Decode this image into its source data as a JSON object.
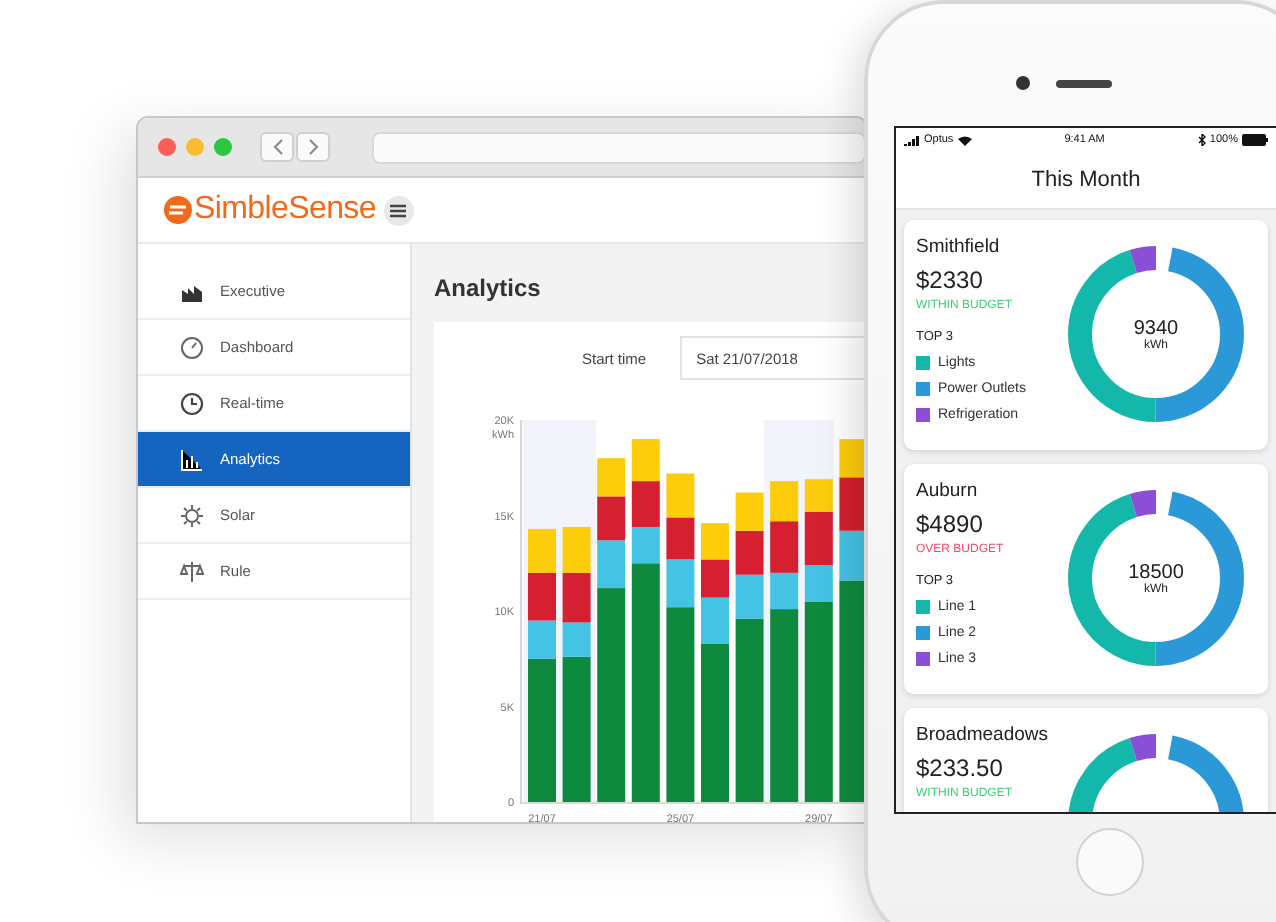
{
  "browser": {
    "logo": "SimbleSense",
    "sidebar": {
      "items": [
        {
          "label": "Executive",
          "kind": "executive",
          "selected": false
        },
        {
          "label": "Dashboard",
          "kind": "dashboard",
          "selected": false
        },
        {
          "label": "Real-time",
          "kind": "realtime",
          "selected": false
        },
        {
          "label": "Analytics",
          "kind": "analytics",
          "selected": true
        },
        {
          "label": "Solar",
          "kind": "solar",
          "selected": false
        },
        {
          "label": "Rule",
          "kind": "rule",
          "selected": false
        }
      ]
    },
    "page_title": "Analytics",
    "start_time": {
      "label": "Start time",
      "value": "Sat 21/07/2018"
    },
    "chart_data": {
      "type": "bar",
      "stacked": true,
      "ylabel": "kWh",
      "ylim": [
        0,
        20000
      ],
      "yticks": [
        {
          "value": 0,
          "label": "0"
        },
        {
          "value": 5000,
          "label": "5K"
        },
        {
          "value": 10000,
          "label": "10K"
        },
        {
          "value": 15000,
          "label": "15K"
        },
        {
          "value": 20000,
          "label": "20K"
        }
      ],
      "categories": [
        "21/07",
        null,
        null,
        null,
        "25/07",
        null,
        null,
        null,
        "29/07",
        null
      ],
      "series": [
        {
          "color": "#0e8a3e",
          "values": [
            7500,
            7600,
            11200,
            12500,
            10200,
            8300,
            9600,
            10100,
            10500,
            11600
          ]
        },
        {
          "color": "#45c3e4",
          "values": [
            2000,
            1800,
            2500,
            1900,
            2500,
            2400,
            2300,
            1900,
            1900,
            2600
          ]
        },
        {
          "color": "#d42030",
          "values": [
            2500,
            2600,
            2300,
            2400,
            2200,
            2000,
            2300,
            2700,
            2800,
            2800
          ]
        },
        {
          "color": "#fdcc0a",
          "values": [
            2300,
            2400,
            2000,
            2200,
            2300,
            1900,
            2000,
            2100,
            1700,
            2000
          ]
        }
      ]
    }
  },
  "phone": {
    "status_bar": {
      "carrier": "Optus",
      "time": "9:41 AM",
      "battery": "100%"
    },
    "title": "This Month",
    "sites": [
      {
        "name": "Smithfield",
        "cost": "$2330",
        "budget_status": "WITHIN BUDGET",
        "over_budget": false,
        "top_label": "TOP 3",
        "total": "9340",
        "unit": "kWh",
        "legend": [
          {
            "label": "Lights",
            "color": "#14b8ab"
          },
          {
            "label": "Power Outlets",
            "color": "#2b98d8"
          },
          {
            "label": "Refrigeration",
            "color": "#8a4fd6"
          }
        ]
      },
      {
        "name": "Auburn",
        "cost": "$4890",
        "budget_status": "OVER BUDGET",
        "over_budget": true,
        "top_label": "TOP 3",
        "total": "18500",
        "unit": "kWh",
        "legend": [
          {
            "label": "Line 1",
            "color": "#14b8ab"
          },
          {
            "label": "Line 2",
            "color": "#2b98d8"
          },
          {
            "label": "Line 3",
            "color": "#8a4fd6"
          }
        ]
      },
      {
        "name": "Broadmeadows",
        "cost": "$233.50",
        "budget_status": "WITHIN BUDGET",
        "over_budget": false
      }
    ]
  }
}
